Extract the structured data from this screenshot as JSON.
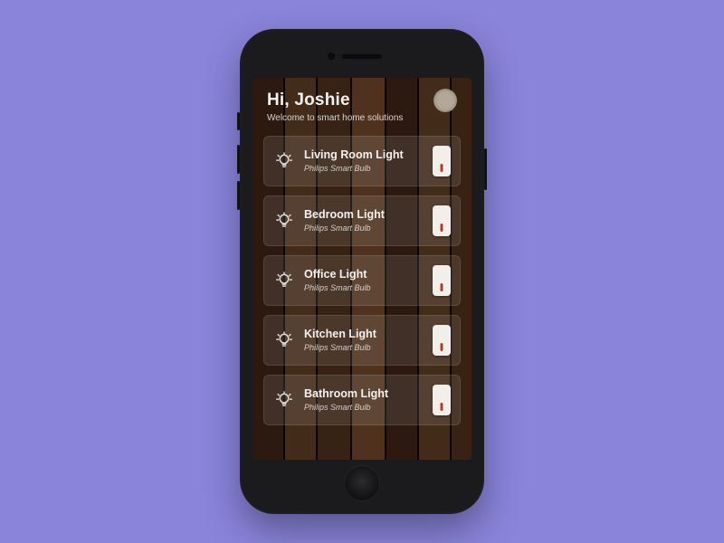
{
  "header": {
    "greeting": "Hi, Joshie",
    "subtitle": "Welcome to smart home solutions"
  },
  "devices": [
    {
      "name": "Living Room Light",
      "sub": "Philips Smart Bulb",
      "on": false
    },
    {
      "name": "Bedroom Light",
      "sub": "Philips Smart Bulb",
      "on": false
    },
    {
      "name": "Office Light",
      "sub": "Philips Smart Bulb",
      "on": false
    },
    {
      "name": "Kitchen Light",
      "sub": "Philips Smart Bulb",
      "on": false
    },
    {
      "name": "Bathroom Light",
      "sub": "Philips Smart Bulb",
      "on": false
    }
  ],
  "colors": {
    "page_bg": "#8a84db",
    "phone_frame": "#1b1b1d",
    "switch_bg": "#f2eee9",
    "switch_indicator": "#b23b2a"
  }
}
